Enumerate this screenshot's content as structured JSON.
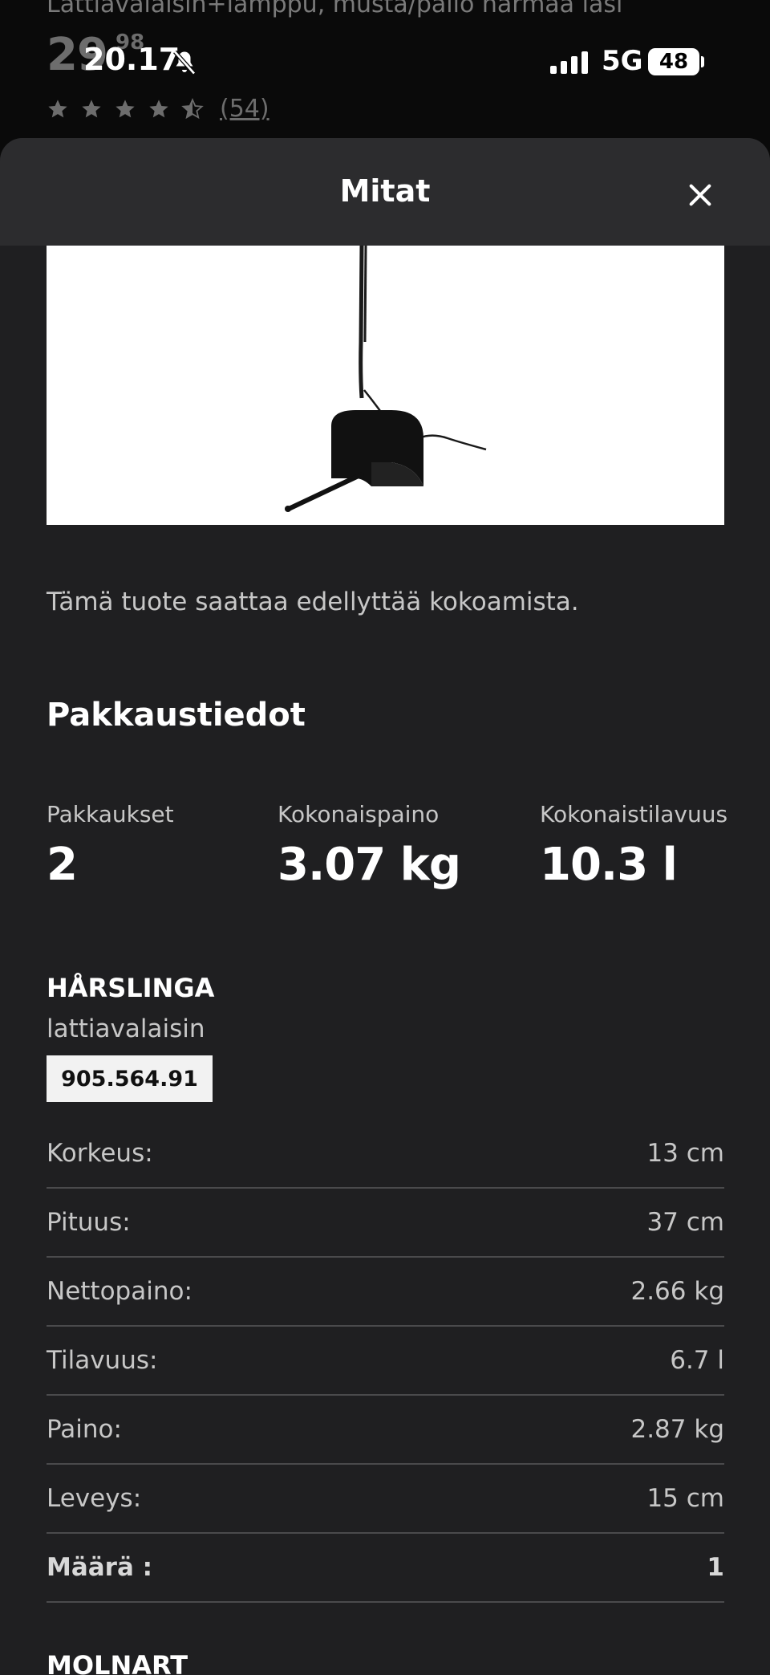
{
  "background": {
    "product_title": "Lattiavalaisin+lamppu, musta/pallo harmaa lasi",
    "price_main": "29",
    "price_decimals": "98",
    "rating": 4.5,
    "review_count": "(54)"
  },
  "status_bar": {
    "time": "20.17",
    "network": "5G",
    "battery": "48"
  },
  "sheet": {
    "title": "Mitat",
    "assembly_note": "Tämä tuote saattaa edellyttää kokoamista.",
    "packaging": {
      "title": "Pakkaustiedot",
      "stats": [
        {
          "label": "Pakkaukset",
          "value": "2"
        },
        {
          "label": "Kokonaispaino",
          "value": "3.07 kg"
        },
        {
          "label": "Kokonaistilavuus",
          "value": "10.3 l"
        }
      ]
    },
    "items": [
      {
        "name": "HÅRSLINGA",
        "type": "lattiavalaisin",
        "article_number": "905.564.91",
        "dimensions": [
          {
            "label": "Korkeus:",
            "value": "13 cm"
          },
          {
            "label": "Pituus:",
            "value": "37 cm"
          },
          {
            "label": "Nettopaino:",
            "value": "2.66 kg"
          },
          {
            "label": "Tilavuus:",
            "value": "6.7 l"
          },
          {
            "label": "Paino:",
            "value": "2.87 kg"
          },
          {
            "label": "Leveys:",
            "value": "15 cm"
          },
          {
            "label": "Määrä :",
            "value": "1"
          }
        ]
      },
      {
        "name": "MOLNART"
      }
    ]
  },
  "colors": {
    "sheet_bg": "#1f1f21",
    "header_bg": "#2c2c2e",
    "divider": "#4a4a4c",
    "text_secondary": "#c7c7c7"
  }
}
